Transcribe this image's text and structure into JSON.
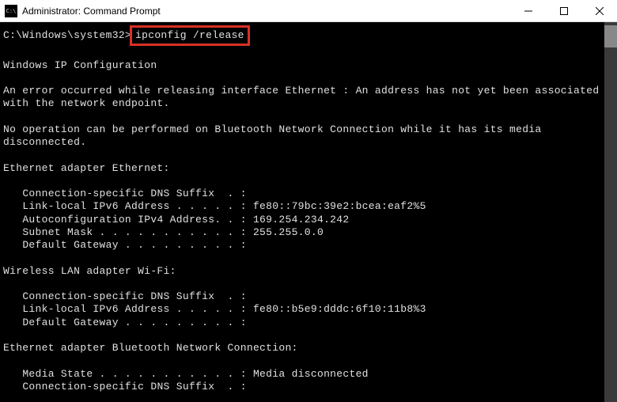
{
  "titlebar": {
    "title": "Administrator: Command Prompt"
  },
  "terminal": {
    "prompt_path": "C:\\Windows\\system32>",
    "command": "ipconfig /release",
    "output": {
      "header": "Windows IP Configuration",
      "error1": "An error occurred while releasing interface Ethernet : An address has not yet been associated with the network endpoint.",
      "error2": "No operation can be performed on Bluetooth Network Connection while it has its media disconnected.",
      "adapter1": {
        "title": "Ethernet adapter Ethernet:",
        "lines": [
          "   Connection-specific DNS Suffix  . :",
          "   Link-local IPv6 Address . . . . . : fe80::79bc:39e2:bcea:eaf2%5",
          "   Autoconfiguration IPv4 Address. . : 169.254.234.242",
          "   Subnet Mask . . . . . . . . . . . : 255.255.0.0",
          "   Default Gateway . . . . . . . . . :"
        ]
      },
      "adapter2": {
        "title": "Wireless LAN adapter Wi-Fi:",
        "lines": [
          "   Connection-specific DNS Suffix  . :",
          "   Link-local IPv6 Address . . . . . : fe80::b5e9:dddc:6f10:11b8%3",
          "   Default Gateway . . . . . . . . . :"
        ]
      },
      "adapter3": {
        "title": "Ethernet adapter Bluetooth Network Connection:",
        "lines": [
          "   Media State . . . . . . . . . . . : Media disconnected",
          "   Connection-specific DNS Suffix  . :"
        ]
      }
    }
  }
}
